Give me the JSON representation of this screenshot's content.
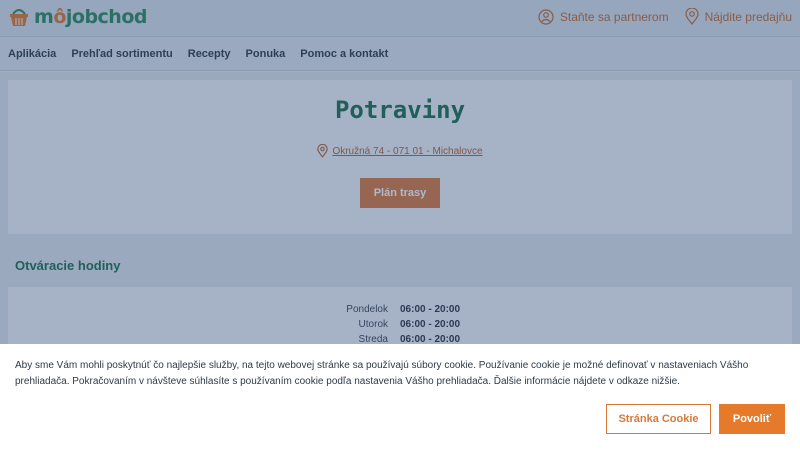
{
  "brand": {
    "logo_text_a": "m",
    "logo_text_o": "ô",
    "logo_text_b": "jobchod"
  },
  "top_actions": [
    {
      "label": "Staňte sa partnerom",
      "icon": "partner-icon"
    },
    {
      "label": "Nájdite predajňu",
      "icon": "location-pin-icon"
    }
  ],
  "nav": [
    "Aplikácia",
    "Prehľad sortimentu",
    "Recepty",
    "Ponuka",
    "Pomoc a kontakt"
  ],
  "store": {
    "title": "Potraviny",
    "address": "Okružná 74 - 071 01 - Michalovce",
    "route_button": "Plán trasy"
  },
  "hours": {
    "heading": "Otváracie hodiny",
    "rows": [
      {
        "day": "Pondelok",
        "time": "06:00 - 20:00"
      },
      {
        "day": "Utorok",
        "time": "06:00 - 20:00"
      },
      {
        "day": "Streda",
        "time": "06:00 - 20:00"
      }
    ]
  },
  "cookie": {
    "text": "Aby sme Vám mohli poskytnúť čo najlepšie služby, na tejto webovej stránke sa používajú súbory cookie. Používanie cookie je možné definovať v nastaveniach Vášho prehliadača. Pokračovaním v návšteve súhlasíte s používaním cookie podľa nastavenia Vášho prehliadača. Ďalšie informácie nájdete v odkaze nižšie.",
    "cookie_page_button": "Stránka Cookie",
    "allow_button": "Povoliť"
  },
  "colors": {
    "brand_green": "#1b6e47",
    "accent_orange": "#d8793a",
    "overlay": "rgba(41,70,120,0.38)"
  }
}
